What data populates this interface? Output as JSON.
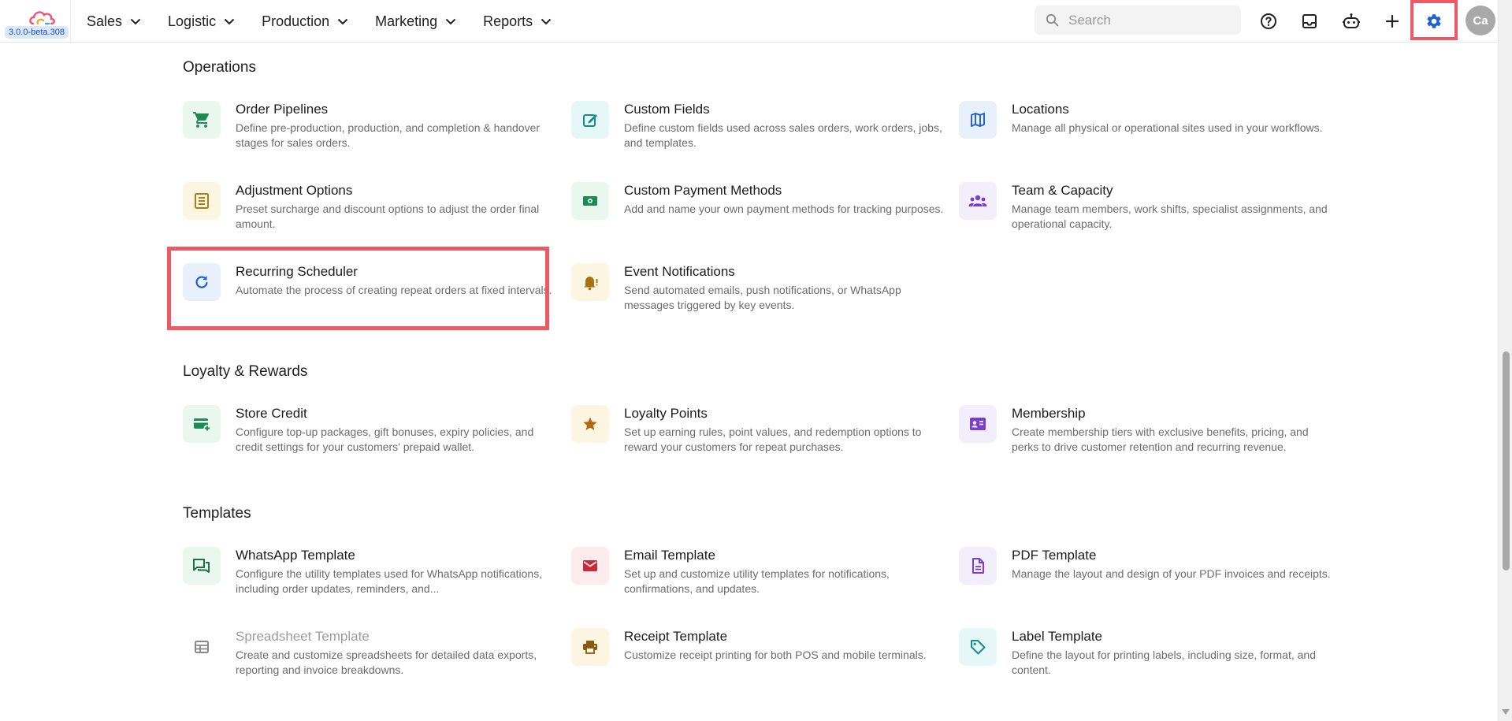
{
  "app": {
    "version": "3.0.0-beta.308"
  },
  "nav": [
    {
      "label": "Sales"
    },
    {
      "label": "Logistic"
    },
    {
      "label": "Production"
    },
    {
      "label": "Marketing"
    },
    {
      "label": "Reports"
    }
  ],
  "search": {
    "placeholder": "Search"
  },
  "user": {
    "initials": "Ca"
  },
  "colors": {
    "accent": "#1f5fd6",
    "highlight": "#ec5a66"
  },
  "sections": {
    "operations": {
      "title": "Operations",
      "items": [
        {
          "title": "Order Pipelines",
          "desc": "Define pre-production, production, and completion & handover stages for sales orders.",
          "icon": "cart-icon"
        },
        {
          "title": "Custom Fields",
          "desc": "Define custom fields used across sales orders, work orders, jobs, and templates.",
          "icon": "edit-icon"
        },
        {
          "title": "Locations",
          "desc": "Manage all physical or operational sites used in your workflows.",
          "icon": "map-icon"
        },
        {
          "title": "Adjustment Options",
          "desc": "Preset surcharge and discount options to adjust the order final amount.",
          "icon": "list-icon"
        },
        {
          "title": "Custom Payment Methods",
          "desc": "Add and name your own payment methods for tracking purposes.",
          "icon": "cash-icon"
        },
        {
          "title": "Team & Capacity",
          "desc": "Manage team members, work shifts, specialist assignments, and operational capacity.",
          "icon": "team-icon"
        },
        {
          "title": "Recurring Scheduler",
          "desc": "Automate the process of creating repeat orders at fixed intervals.",
          "icon": "refresh-icon"
        },
        {
          "title": "Event Notifications",
          "desc": "Send automated emails, push notifications, or WhatsApp messages triggered by key events.",
          "icon": "bell-icon"
        }
      ]
    },
    "loyalty": {
      "title": "Loyalty & Rewards",
      "items": [
        {
          "title": "Store Credit",
          "desc": "Configure top-up packages, gift bonuses, expiry policies, and credit settings for your customers' prepaid wallet.",
          "icon": "card-add-icon"
        },
        {
          "title": "Loyalty Points",
          "desc": "Set up earning rules, point values, and redemption options to reward your customers for repeat purchases.",
          "icon": "star-icon"
        },
        {
          "title": "Membership",
          "desc": "Create membership tiers with exclusive benefits, pricing, and perks to drive customer retention and recurring revenue.",
          "icon": "id-card-icon"
        }
      ]
    },
    "templates": {
      "title": "Templates",
      "items": [
        {
          "title": "WhatsApp Template",
          "desc": "Configure the utility templates used for WhatsApp notifications, including order updates, reminders, and...",
          "icon": "chat-icon"
        },
        {
          "title": "Email Template",
          "desc": "Set up and customize utility templates for notifications, confirmations, and updates.",
          "icon": "mail-icon"
        },
        {
          "title": "PDF Template",
          "desc": "Manage the layout and design of your PDF invoices and receipts.",
          "icon": "document-icon"
        },
        {
          "title": "Spreadsheet Template",
          "desc": "Create and customize spreadsheets for detailed data exports, reporting and invoice breakdowns.",
          "icon": "table-icon"
        },
        {
          "title": "Receipt Template",
          "desc": "Customize receipt printing for both POS and mobile terminals.",
          "icon": "printer-icon"
        },
        {
          "title": "Label Template",
          "desc": "Define the layout for printing labels, including size, format, and content.",
          "icon": "tag-icon"
        }
      ]
    }
  }
}
